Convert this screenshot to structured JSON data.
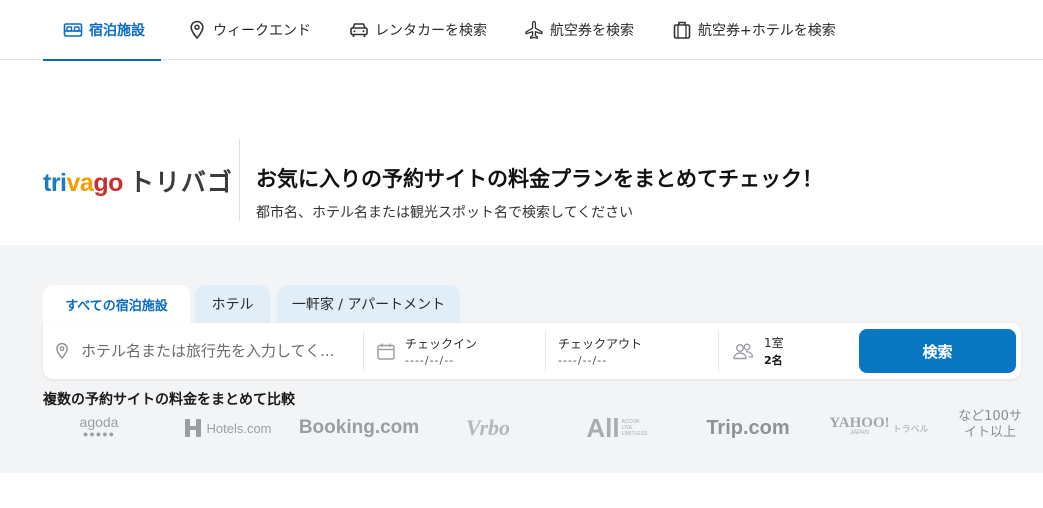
{
  "nav": {
    "tabs": [
      {
        "label": "宿泊施設",
        "icon": "bed-icon",
        "active": true
      },
      {
        "label": "ウィークエンド",
        "icon": "location-pin-icon",
        "active": false
      },
      {
        "label": "レンタカーを検索",
        "icon": "car-icon",
        "active": false
      },
      {
        "label": "航空券を検索",
        "icon": "airplane-icon",
        "active": false
      },
      {
        "label": "航空券+ホテルを検索",
        "icon": "luggage-icon",
        "active": false
      }
    ]
  },
  "brand": {
    "logo_latin": "trivago",
    "logo_kana": "トリバゴ",
    "colors": {
      "tri": "#1a7bbf",
      "va": "#f59c00",
      "go": "#c9302c",
      "accent": "#0a6cc0",
      "button": "#0a77c2"
    }
  },
  "hero": {
    "headline": "お気に入りの予約サイトの料金プランをまとめてチェック！",
    "subline": "都市名、ホテル名または観光スポット名で検索してください"
  },
  "search": {
    "tabs": [
      {
        "label": "すべての宿泊施設",
        "active": true
      },
      {
        "label": "ホテル",
        "active": false
      },
      {
        "label": "一軒家 / アパートメント",
        "active": false
      }
    ],
    "destination_placeholder": "ホテル名または旅行先を入力してく...",
    "checkin_label": "チェックイン",
    "checkin_value": "----/--/--",
    "checkout_label": "チェックアウト",
    "checkout_value": "----/--/--",
    "rooms": "1室",
    "guests": "2名",
    "submit_label": "検索"
  },
  "compare": {
    "title": "複数の予約サイトの料金をまとめて比較",
    "partners": [
      "agoda",
      "Hotels.com",
      "Booking.com",
      "Vrbo",
      "All",
      "Trip.com",
      "YAHOO!",
      "JAPAN",
      "トラベル"
    ],
    "agoda_dots": "●●●●●",
    "all_sub": "ACCOR LIVE LIMITLESS",
    "more_line1": "など100サ",
    "more_line2": "イト以上"
  }
}
